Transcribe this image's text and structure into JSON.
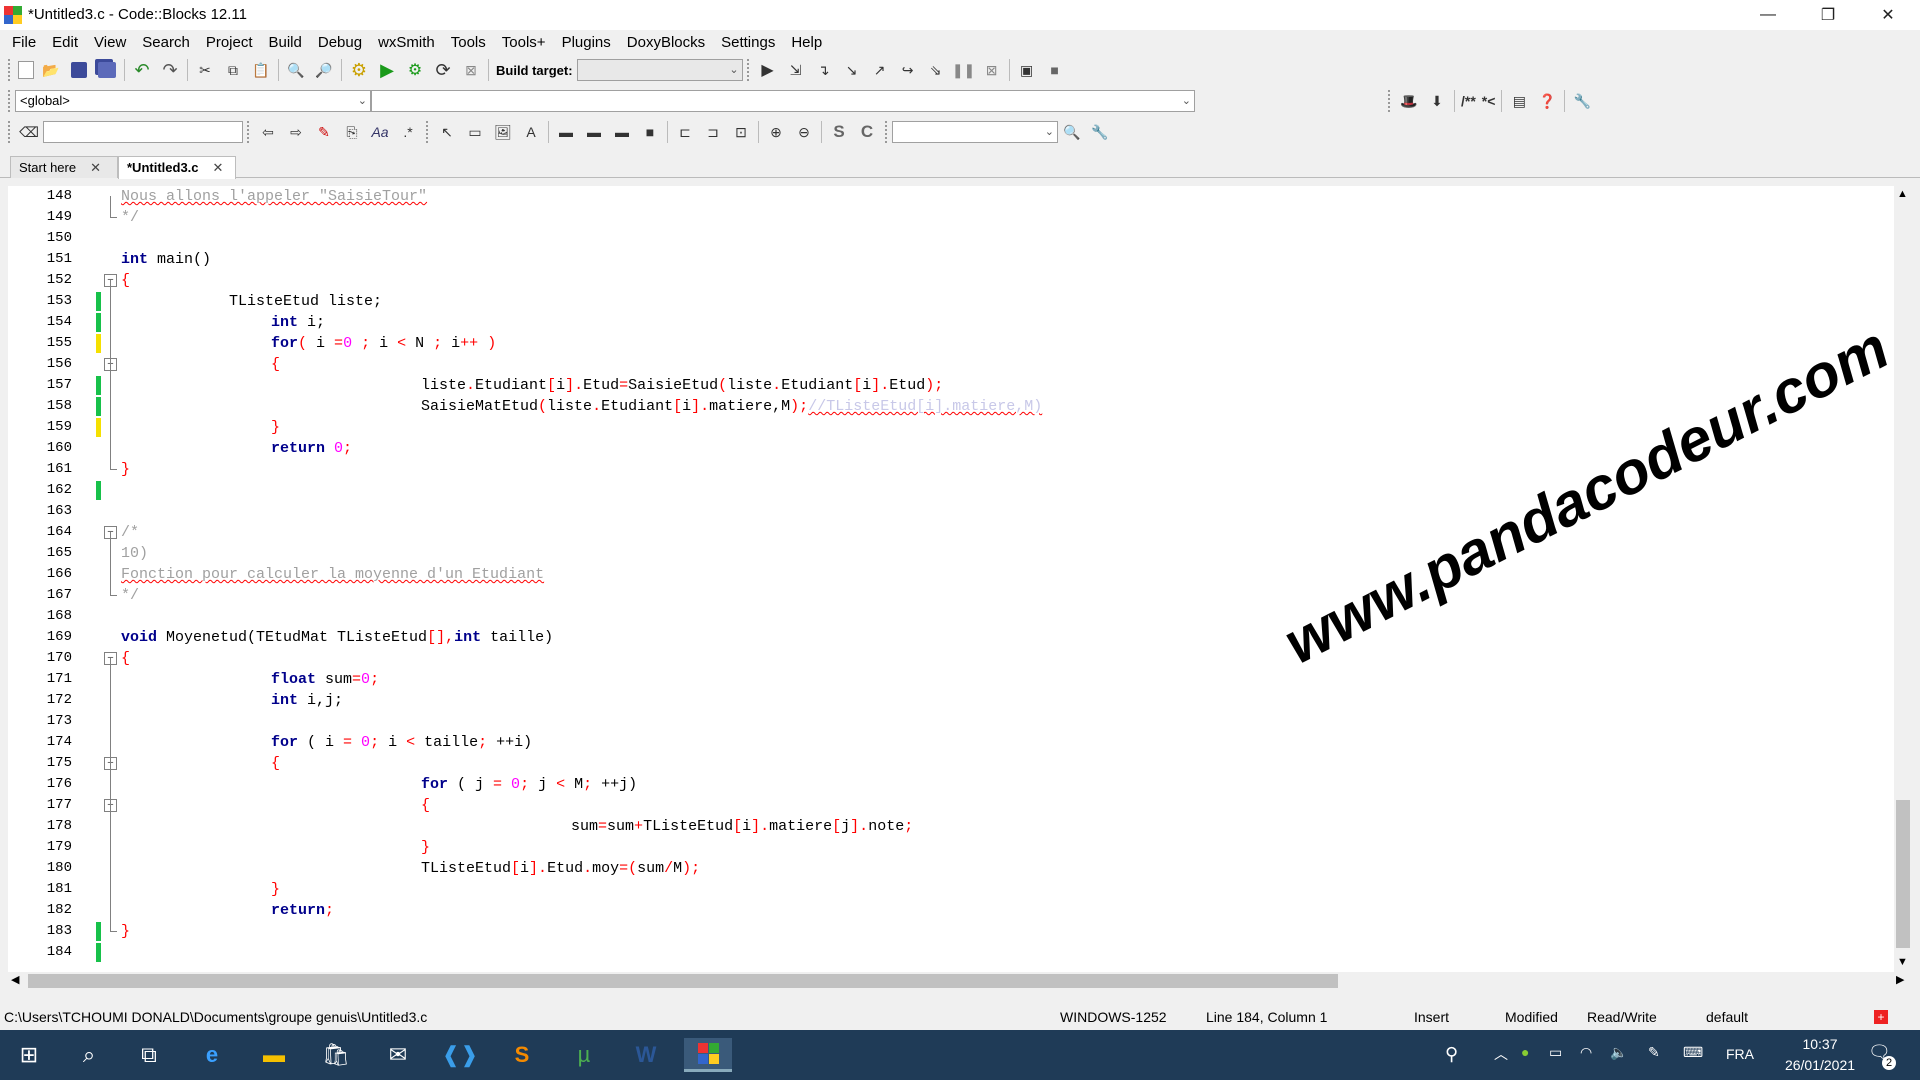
{
  "window": {
    "title": "*Untitled3.c - Code::Blocks 12.11",
    "minimize": "—",
    "maximize": "❐",
    "close": "✕"
  },
  "menu": [
    "File",
    "Edit",
    "View",
    "Search",
    "Project",
    "Build",
    "Debug",
    "wxSmith",
    "Tools",
    "Tools+",
    "Plugins",
    "DoxyBlocks",
    "Settings",
    "Help"
  ],
  "toolbar": {
    "build_target_label": "Build target:",
    "scope_combo": "<global>",
    "doxy_comment": "/**",
    "doxy_line": "*<",
    "jump_s": "S",
    "jump_c": "C"
  },
  "tabs": [
    {
      "label": "Start here",
      "close": "✕"
    },
    {
      "label": "*Untitled3.c",
      "close": "✕"
    }
  ],
  "editor": {
    "line_numbers": [
      "148",
      "149",
      "150",
      "151",
      "152",
      "153",
      "154",
      "155",
      "156",
      "157",
      "158",
      "159",
      "160",
      "161",
      "162",
      "163",
      "164",
      "165",
      "166",
      "167",
      "168",
      "169",
      "170",
      "171",
      "172",
      "173",
      "174",
      "175",
      "176",
      "177",
      "178",
      "179",
      "180",
      "181",
      "182",
      "183",
      "184"
    ],
    "code_text": {
      "l148": "Nous allons l'appeler \"SaisieTour\"",
      "l149": "*/",
      "l151_kw": "int",
      "l151_rest": " main()",
      "l152": "{",
      "l153": "            TListeEtud liste;",
      "l154_kw": "int",
      "l154_rest": " i;",
      "l155_kw": "for",
      "l155_a": "( ",
      "l155_b": "i ",
      "l155_c": "=",
      "l155_d": "0",
      "l155_e": " ; ",
      "l155_f": "i ",
      "l155_g": "<",
      "l155_h": " N ",
      "l155_i": ";",
      "l155_j": " i",
      "l155_k": "++",
      "l155_l": " )",
      "l156": "{",
      "l157_a": "liste",
      "l157_b": ".",
      "l157_c": "Etudiant",
      "l157_d": "[",
      "l157_e": "i",
      "l157_f": "].",
      "l157_g": "Etud",
      "l157_h": "=",
      "l157_i": "SaisieEtud",
      "l157_j": "(",
      "l157_k": "liste",
      "l157_l": ".",
      "l157_m": "Etudiant",
      "l157_n": "[",
      "l157_o": "i",
      "l157_p": "].",
      "l157_q": "Etud",
      "l157_r": ");",
      "l158_a": "SaisieMatEtud",
      "l158_b": "(",
      "l158_c": "liste",
      "l158_d": ".",
      "l158_e": "Etudiant",
      "l158_f": "[",
      "l158_g": "i",
      "l158_h": "].",
      "l158_i": "matiere",
      "l158_j": ",M",
      ")": ")",
      "l158_k": ");",
      "l158_cm": "//TListeEtud[i].matiere,M)",
      "l159": "}",
      "l160_kw": "return",
      "l160_num": "0",
      "l160_end": ";",
      "l161": "}",
      "l164": "/*",
      "l165": "10)",
      "l166": "Fonction pour calculer la moyenne d'un Etudiant",
      "l167": "*/",
      "l169_kw1": "void",
      "l169_a": " Moyenetud(TEtudMat TListeEtud",
      "l169_b": "[],",
      "l169_kw2": "int",
      "l169_c": " taille)",
      "l170": "{",
      "l171_kw": "float",
      "l171_a": " sum",
      "l171_b": "=",
      "l171_c": "0",
      "l171_d": ";",
      "l172_kw": "int",
      "l172_rest": " i,j;",
      "l174_kw": "for",
      "l174_a": " ( i ",
      "l174_b": "=",
      "l174_c": " 0",
      "l174_d": ";",
      " l174_e": "",
      "l174_e": " i ",
      "l174_f": "<",
      "l174_g": " taille",
      "l174_h": ";",
      "l174_i": " ++i)",
      "l175": "{",
      "l176_kw": "for",
      "l176_a": " ( j ",
      "l176_b": "=",
      "l176_c": " 0",
      "l176_d": ";",
      "l176_e": " j ",
      "l176_f": "<",
      "l176_g": " M",
      "l176_h": ";",
      "l176_i": " ++j)",
      "l177": "{",
      "l178_a": "sum",
      "l178_b": "=",
      "l178_c": "sum",
      "l178_d": "+",
      "l178_e": "TListeEtud",
      "l178_f": "[",
      "l178_g": "i",
      "l178_h": "].",
      "l178_i": "matiere",
      "l178_j": "[",
      "l178_k": "j",
      "l178_l": "].",
      "l178_m": "note",
      "l178_n": ";",
      "l179": "}",
      "l180_a": "TListeEtud",
      "l180_b": "[",
      "l180_c": "i",
      "l180_d": "].",
      "l180_e": "Etud",
      "l180_f": ".",
      "l180_g": "moy",
      "l180_h": "=(",
      "l180_i": "sum",
      "l180_j": "/",
      "l180_k": "M",
      "l180_l": ");",
      "l181": "}",
      "l182_kw": "return",
      "l182_end": ";",
      "l183": "}"
    },
    "watermark": "www.pandacodeur.com"
  },
  "status": {
    "path": "C:\\Users\\TCHOUMI DONALD\\Documents\\groupe genuis\\Untitled3.c",
    "encoding": "WINDOWS-1252",
    "position": "Line 184, Column 1",
    "mode": "Insert",
    "modified": "Modified",
    "access": "Read/Write",
    "profile": "default"
  },
  "taskbar": {
    "lang": "FRA",
    "time": "10:37",
    "date": "26/01/2021",
    "notif_count": "2"
  },
  "colors": {
    "keyword": "#00008b",
    "number": "#ff00ff",
    "operator": "#ff0000",
    "comment": "#a0a0a0",
    "change_saved": "#17c14a",
    "change_unsaved": "#f5e000",
    "taskbar": "#1f3b57"
  }
}
